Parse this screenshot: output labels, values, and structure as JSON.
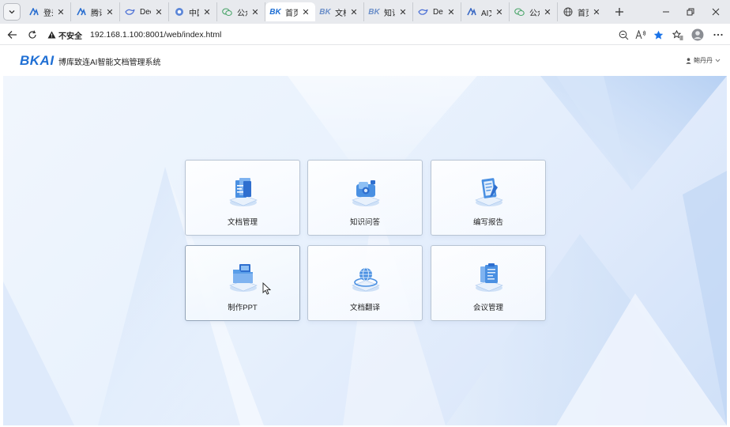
{
  "browser": {
    "tabs": [
      {
        "title": "登录",
        "favicon": "bkai-a-icon",
        "active": false
      },
      {
        "title": "腾讯/",
        "favicon": "bkai-a-icon",
        "active": false
      },
      {
        "title": "Deep",
        "favicon": "deepseek-whale-icon",
        "active": false
      },
      {
        "title": "中国.",
        "favicon": "globe-circle-icon",
        "active": false
      },
      {
        "title": "公众·",
        "favicon": "wechat-icon",
        "active": false
      },
      {
        "title": "首页",
        "favicon": "bk-logo-icon",
        "active": true
      },
      {
        "title": "文档",
        "favicon": "bk-logo-icon",
        "active": false
      },
      {
        "title": "知识",
        "favicon": "bk-logo-icon",
        "active": false
      },
      {
        "title": "Deep",
        "favicon": "deepseek-whale-icon",
        "active": false
      },
      {
        "title": "AI文",
        "favicon": "ai-doc-icon",
        "active": false
      },
      {
        "title": "公众·",
        "favicon": "wechat-icon",
        "active": false
      },
      {
        "title": "首页",
        "favicon": "globe-icon",
        "active": false
      }
    ],
    "security_label": "不安全",
    "url": "192.168.1.100:8001/web/index.html"
  },
  "app": {
    "logo_text": "BKAI",
    "title": "博库致连AI智能文档管理系统",
    "user_name": "鲍丹丹"
  },
  "cards": [
    {
      "label": "文档管理",
      "icon": "document-folder-icon"
    },
    {
      "label": "知识问答",
      "icon": "knowledge-chat-icon"
    },
    {
      "label": "编写报告",
      "icon": "report-writing-icon"
    },
    {
      "label": "制作PPT",
      "icon": "ppt-folder-icon"
    },
    {
      "label": "文档翻译",
      "icon": "translate-globe-icon"
    },
    {
      "label": "会议管理",
      "icon": "meeting-clipboard-icon"
    }
  ],
  "colors": {
    "brand": "#1f6fd4",
    "accent_blue": "#3b8ae6",
    "card_border": "#b8c4d3"
  }
}
